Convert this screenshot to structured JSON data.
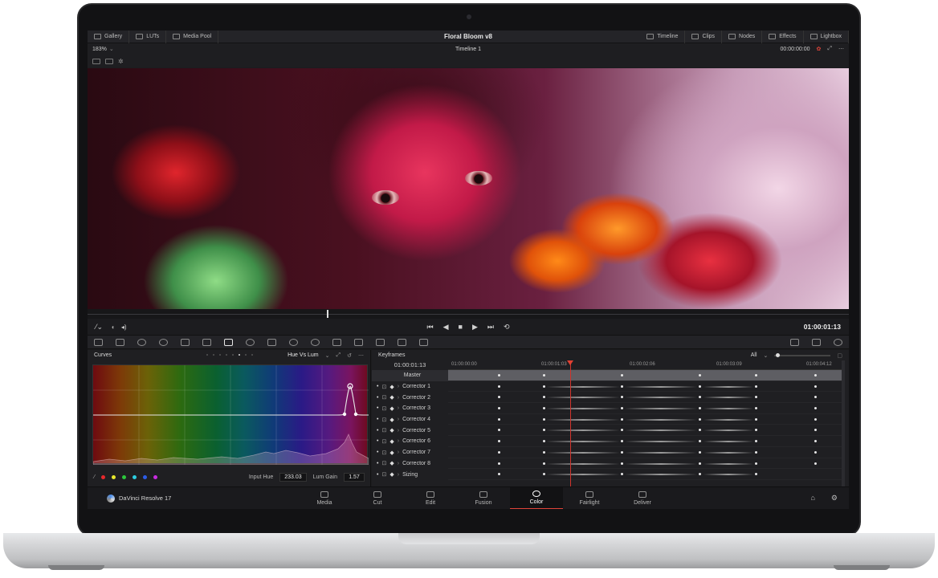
{
  "app": {
    "project_title": "Floral Bloom v8",
    "brand_name": "DaVinci Resolve 17"
  },
  "topbar": {
    "left": [
      {
        "label": "Gallery",
        "icon": "gallery-icon"
      },
      {
        "label": "LUTs",
        "icon": "luts-icon"
      },
      {
        "label": "Media Pool",
        "icon": "media-pool-icon"
      }
    ],
    "right": [
      {
        "label": "Timeline",
        "icon": "timeline-icon"
      },
      {
        "label": "Clips",
        "icon": "clips-icon"
      },
      {
        "label": "Nodes",
        "icon": "nodes-icon"
      },
      {
        "label": "Effects",
        "icon": "effects-icon"
      },
      {
        "label": "Lightbox",
        "icon": "lightbox-icon"
      }
    ]
  },
  "viewer": {
    "zoom": "183%",
    "timeline_name": "Timeline 1",
    "source_timecode": "00:00:00:00",
    "current_timecode": "01:00:01:13"
  },
  "transport": {
    "controls": [
      "⏮",
      "◀",
      "■",
      "▶",
      "⏭",
      "⟲"
    ]
  },
  "curves": {
    "title": "Curves",
    "mode": "Hue Vs Lum",
    "input_hue_label": "Input Hue",
    "input_hue_value": "233.03",
    "lum_gain_label": "Lum Gain",
    "lum_gain_value": "1.57",
    "swatches": [
      "#e8282c",
      "#e8e82c",
      "#2cc83c",
      "#2ccce0",
      "#2c5ce8",
      "#c82ce0"
    ]
  },
  "keyframes": {
    "title": "Keyframes",
    "filter": "All",
    "timecode": "01:00:01:13",
    "ruler": [
      "01:00:00:00",
      "01:00:01:03",
      "01:00:02:06",
      "01:00:03:09",
      "01:00:04:12"
    ],
    "master_label": "Master",
    "rows": [
      "Corrector 1",
      "Corrector 2",
      "Corrector 3",
      "Corrector 4",
      "Corrector 5",
      "Corrector 6",
      "Corrector 7",
      "Corrector 8",
      "Sizing"
    ]
  },
  "pages": [
    {
      "label": "Media",
      "active": false
    },
    {
      "label": "Cut",
      "active": false
    },
    {
      "label": "Edit",
      "active": false
    },
    {
      "label": "Fusion",
      "active": false
    },
    {
      "label": "Color",
      "active": true
    },
    {
      "label": "Fairlight",
      "active": false
    },
    {
      "label": "Deliver",
      "active": false
    }
  ],
  "accent_color": "#e0443a"
}
